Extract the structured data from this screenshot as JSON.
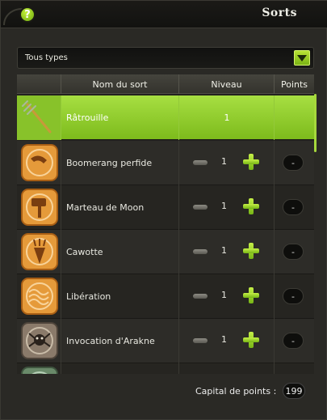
{
  "window": {
    "title": "Sorts",
    "help_label": "?"
  },
  "filter": {
    "value": "Tous types"
  },
  "table": {
    "headers": [
      "",
      "Nom du sort",
      "Niveau",
      "Points"
    ],
    "rows": [
      {
        "name": "Râtrouille",
        "level": "1",
        "points": "",
        "icon": "pitchfork-icon",
        "selected": true
      },
      {
        "name": "Boomerang perfide",
        "level": "1",
        "points": "-",
        "icon": "boomerang-icon",
        "selected": false
      },
      {
        "name": "Marteau de Moon",
        "level": "1",
        "points": "-",
        "icon": "hammer-icon",
        "selected": false
      },
      {
        "name": "Cawotte",
        "level": "1",
        "points": "-",
        "icon": "carrot-icon",
        "selected": false
      },
      {
        "name": "Libération",
        "level": "1",
        "points": "-",
        "icon": "waves-icon",
        "selected": false
      },
      {
        "name": "Invocation d'Arakne",
        "level": "1",
        "points": "-",
        "icon": "spider-icon",
        "selected": false
      }
    ]
  },
  "footer": {
    "label": "Capital de points :",
    "value": "199"
  },
  "colors": {
    "accent": "#8cc63f",
    "background": "#2a2925"
  }
}
